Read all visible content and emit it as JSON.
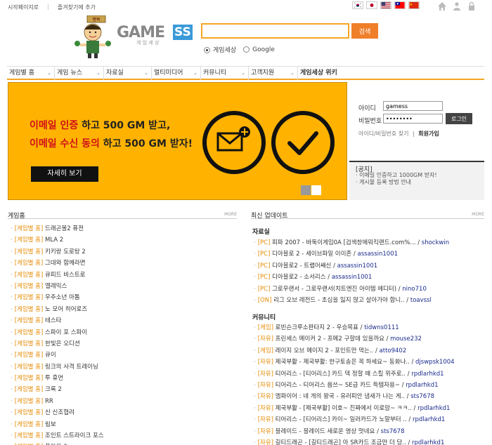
{
  "top": {
    "links": [
      "시작페이지로",
      "즐겨찾기에 추가"
    ]
  },
  "mascot": {
    "badge": "행복"
  },
  "logo": {
    "text": "GAME",
    "sub": "게 임 세 상",
    "tag": "SS"
  },
  "search": {
    "value": "",
    "button": "검색",
    "options": [
      "게임세상",
      "Google"
    ]
  },
  "nav": [
    "게임별 홈",
    "게임 뉴스",
    "자료실",
    "멀티미디어",
    "커뮤니티",
    "고객지원",
    "게임세상 위키"
  ],
  "banner": {
    "line1_a": "이메일 인증",
    "line1_b": " 하고 500 GM 받고,",
    "line2_a": "이메일 수신 동의",
    "line2_b": " 하고 500 GM 받자!",
    "button": "자세히 보기"
  },
  "login": {
    "id_label": "아이디",
    "pw_label": "비밀번호",
    "id_value": "gamess",
    "pw_value": "••••••••",
    "button": "로그인",
    "find": "아이디/비밀번호 찾기",
    "sep": "|",
    "join": "회원가입"
  },
  "notice": {
    "title": "[공지]",
    "items": [
      "· 이메일 인증하고 1000GM 받자!",
      "· 게시물 등록 방법 안내"
    ]
  },
  "game_home": {
    "title": "게임홈",
    "more": "MORE",
    "tag": "[게임별 홈]",
    "items": [
      "드래곤볼2 퓨전",
      "MLA 2",
      "키키랑 도로탕 2",
      "그대와 함께라면",
      "큐피드 비스트로",
      "엘레믹스",
      "우주소년 아톰",
      "노 모어 히어로즈",
      "테스타",
      "스파이 포 스파이",
      "한빛은 오디션",
      "큐이",
      "링크의 사격 트레이닝",
      "투 휴먼",
      "크록 2",
      "RR",
      "신 신조협려",
      "림보",
      "조인트 스트라이크 포스",
      "폴아웃 3"
    ]
  },
  "updates": {
    "title": "최신 업데이트",
    "more": "MORE",
    "pds_title": "자료실",
    "pds": [
      {
        "tag": "[PC]",
        "text": " 피파 2007 - 바둑이게임0A  [검색창에워킥랜드.com%... / ",
        "author": "shockwin"
      },
      {
        "tag": "[PC]",
        "text": " 디아블로 2 - 세이브파일 이이존 / ",
        "author": "assassin1001"
      },
      {
        "tag": "[PC]",
        "text": " 디아블로2 - 트랩어쌔신 / ",
        "author": "assassin1001"
      },
      {
        "tag": "[PC]",
        "text": " 디아블로2 - 소서리스 / ",
        "author": "assassin1001"
      },
      {
        "tag": "[PC]",
        "text": " 그로우랜서 - 그로우랜서(치트엔진 아이템 에디터) / ",
        "author": "nino710"
      },
      {
        "tag": "[ON]",
        "text": " 리그 오브 레전드 - 초심을 잃지 않고 살아가야 합니.. / ",
        "author": "toavssl"
      }
    ],
    "comm_title": "커뮤니티",
    "comm": [
      {
        "tag": "[게임]",
        "text": " 로빈슨크루소판타지 2 - 우승목표 / ",
        "author": "tidwns0111"
      },
      {
        "tag": "[자유]",
        "text": " 프린세스 메이커 2 - 프메2 구할데 있을까요 / ",
        "author": "mouse232"
      },
      {
        "tag": "[게임]",
        "text": " 레이지 오브 메이지 2 - 포인트만 먹는.. / ",
        "author": "atto9402"
      },
      {
        "tag": "[자유]",
        "text": " 제국부활 - 제국부활: 한구토송은 꼭 하세요~ 동화나.. / ",
        "author": "djswpsk1004"
      },
      {
        "tag": "[자유]",
        "text": " 티어리스 - [티어리스] 카드 덱 정할 때 스킬 위주로.. / ",
        "author": "rpdlarhkd1"
      },
      {
        "tag": "[자유]",
        "text": " 티어리스 - 티어리스 옵쓰~ SE급 카드 득템자용~ / ",
        "author": "rpdlarhkd1"
      },
      {
        "tag": "[자유]",
        "text": " 엠파이어 : 네 개의 왕국 - 유러피안 냄새가 나는 게.. / ",
        "author": "sts7678"
      },
      {
        "tag": "[자유]",
        "text": " 제국부활 - [제국부활] 이호~ 진짜에서 이로맘~ ㅋㅋ.. / ",
        "author": "rpdlarhkd1"
      },
      {
        "tag": "[자유]",
        "text": " 티어리스 - [티어리스] 카이~ 일러카드가 노말부터 .. / ",
        "author": "rpdlarhkd1"
      },
      {
        "tag": "[자유]",
        "text": " 블레이드 - 블레이드 새로운 영상 멋네요 / ",
        "author": "sts7678"
      },
      {
        "tag": "[자유]",
        "text": " 길티드래곤 - [길티드래곤] 아 SR카드 조금만 더 당.. / ",
        "author": "rpdlarhkd1"
      }
    ]
  }
}
